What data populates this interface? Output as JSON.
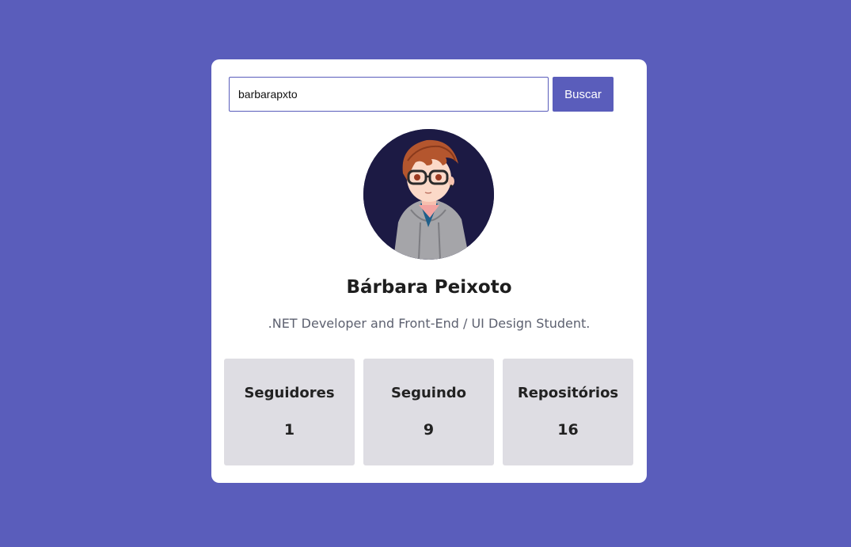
{
  "search": {
    "value": "barbarapxto",
    "button_label": "Buscar"
  },
  "profile": {
    "avatar_icon": "avatar-illustration",
    "name": "Bárbara Peixoto",
    "bio": ".NET Developer and Front-End / UI Design Student."
  },
  "stats": [
    {
      "label": "Seguidores",
      "value": "1"
    },
    {
      "label": "Seguindo",
      "value": "9"
    },
    {
      "label": "Repositórios",
      "value": "16"
    }
  ],
  "colors": {
    "background": "#5a5dbb",
    "accent": "#5a5dbb",
    "card": "#ffffff",
    "stat_box": "#dedde3"
  }
}
